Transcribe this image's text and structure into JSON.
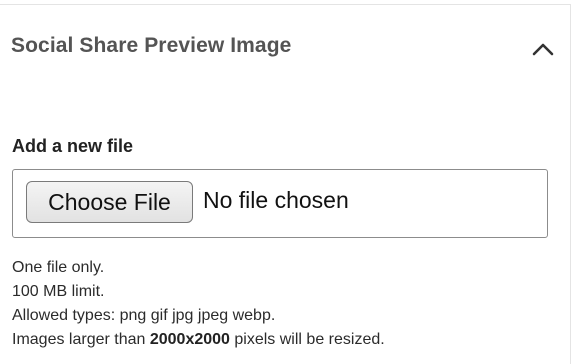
{
  "panel": {
    "title": "Social Share Preview Image",
    "toggle_icon": "chevron-up-icon",
    "expanded": true
  },
  "field": {
    "label": "Add a new file",
    "button_label": "Choose File",
    "status": "No file chosen"
  },
  "help": {
    "file_count": "One file only.",
    "size_limit": "100 MB limit.",
    "allowed_types": "Allowed types: png gif jpg jpeg webp.",
    "resize_prefix": "Images larger than ",
    "resize_dimensions": "2000x2000",
    "resize_suffix": " pixels will be resized."
  },
  "colors": {
    "title": "#545454",
    "text": "#222222",
    "border": "#8c8c8c"
  }
}
